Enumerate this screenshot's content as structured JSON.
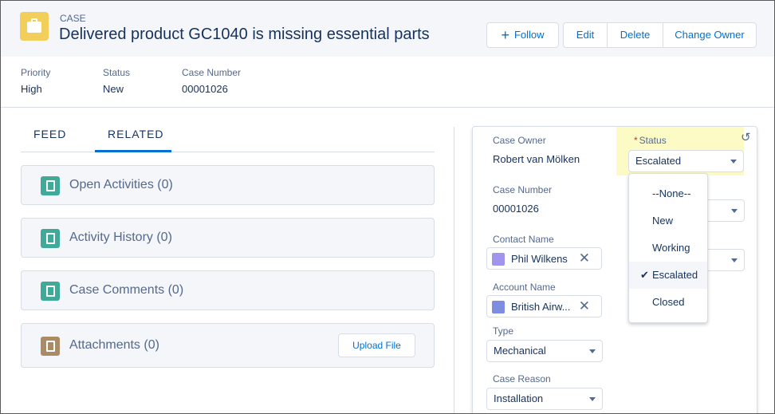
{
  "header": {
    "object_label": "CASE",
    "title": "Delivered product GC1040 is missing essential parts",
    "icon": "briefcase-icon",
    "buttons": {
      "follow": "Follow",
      "edit": "Edit",
      "delete": "Delete",
      "change_owner": "Change Owner"
    }
  },
  "highlights": [
    {
      "label": "Priority",
      "value": "High"
    },
    {
      "label": "Status",
      "value": "New"
    },
    {
      "label": "Case Number",
      "value": "00001026"
    }
  ],
  "tabs": [
    {
      "label": "FEED"
    },
    {
      "label": "RELATED",
      "active": true
    }
  ],
  "related": [
    {
      "title": "Open Activities (0)",
      "icon": "activities-icon"
    },
    {
      "title": "Activity History (0)",
      "icon": "activity-history-icon"
    },
    {
      "title": "Case Comments (0)",
      "icon": "comments-icon"
    },
    {
      "title": "Attachments (0)",
      "icon": "attachment-icon",
      "action": "Upload File"
    }
  ],
  "edit_panel": {
    "case_owner": {
      "label": "Case Owner",
      "value": "Robert van Mölken"
    },
    "status": {
      "label": "Status",
      "value": "Escalated",
      "required": "*"
    },
    "case_number": {
      "label": "Case Number",
      "value": "00001026"
    },
    "contact_name": {
      "label": "Contact Name",
      "value": "Phil Wilkens"
    },
    "account_name": {
      "label": "Account Name",
      "value": "British Airw..."
    },
    "type": {
      "label": "Type",
      "value": "Mechanical"
    },
    "case_reason": {
      "label": "Case Reason",
      "value": "Installation"
    },
    "clear_glyph": "✕",
    "undo_glyph": "↺"
  },
  "status_dropdown": {
    "options": [
      "--None--",
      "New",
      "Working",
      "Escalated",
      "Closed"
    ],
    "selected": "Escalated",
    "check_glyph": "✔"
  },
  "colors": {
    "accent": "#0070d2",
    "case_icon": "#f2cf5b",
    "status_highlight": "#fdfbc5"
  }
}
